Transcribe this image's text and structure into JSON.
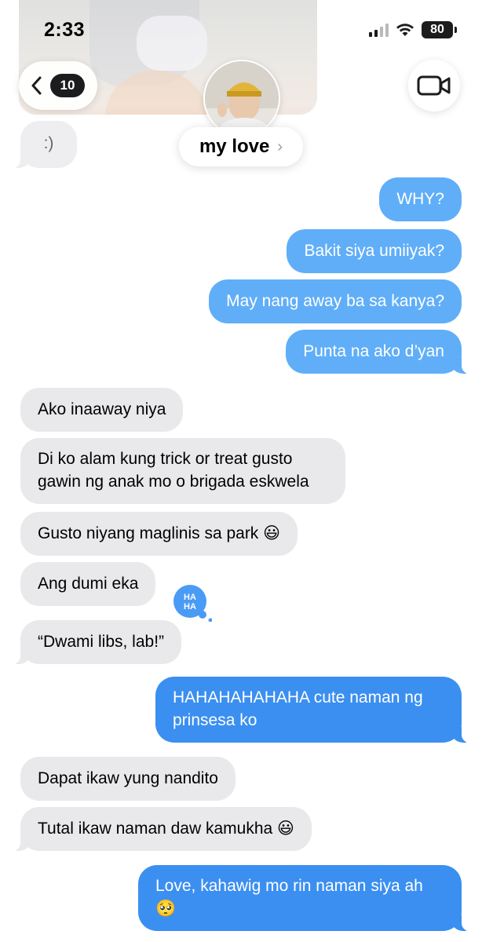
{
  "status_bar": {
    "time": "2:33",
    "battery": "80"
  },
  "nav": {
    "back_count": "10"
  },
  "contact": {
    "name": "my love",
    "chevron": "›"
  },
  "colors": {
    "outgoing": "#60aef8",
    "incoming": "#e9e9eb",
    "tapback": "#4a9bf5"
  },
  "tapback": {
    "label": "HAHA"
  },
  "messages": [
    {
      "side": "in",
      "text": ":)"
    },
    {
      "side": "out",
      "text": "WHY?"
    },
    {
      "side": "out",
      "text": "Bakit siya umiiyak?"
    },
    {
      "side": "out",
      "text": "May nang away ba sa kanya?"
    },
    {
      "side": "out",
      "text": "Punta na ako d’yan"
    },
    {
      "side": "in",
      "text": "Ako inaaway niya"
    },
    {
      "side": "in",
      "text": "Di ko alam kung trick or treat gusto\ngawin ng anak mo o brigada eskwela"
    },
    {
      "side": "in",
      "text": "Gusto niyang maglinis sa park 😃"
    },
    {
      "side": "in",
      "text": "Ang dumi eka"
    },
    {
      "side": "in",
      "text": "“Dwami libs, lab!”"
    },
    {
      "side": "out",
      "text": "HAHAHAHAHAHA cute naman ng\nprinsesa ko"
    },
    {
      "side": "in",
      "text": "Dapat ikaw yung nandito"
    },
    {
      "side": "in",
      "text": "Tutal ikaw naman daw kamukha 😃"
    },
    {
      "side": "out",
      "text": "Love, kahawig mo rin naman siya ah\n🥺"
    }
  ]
}
